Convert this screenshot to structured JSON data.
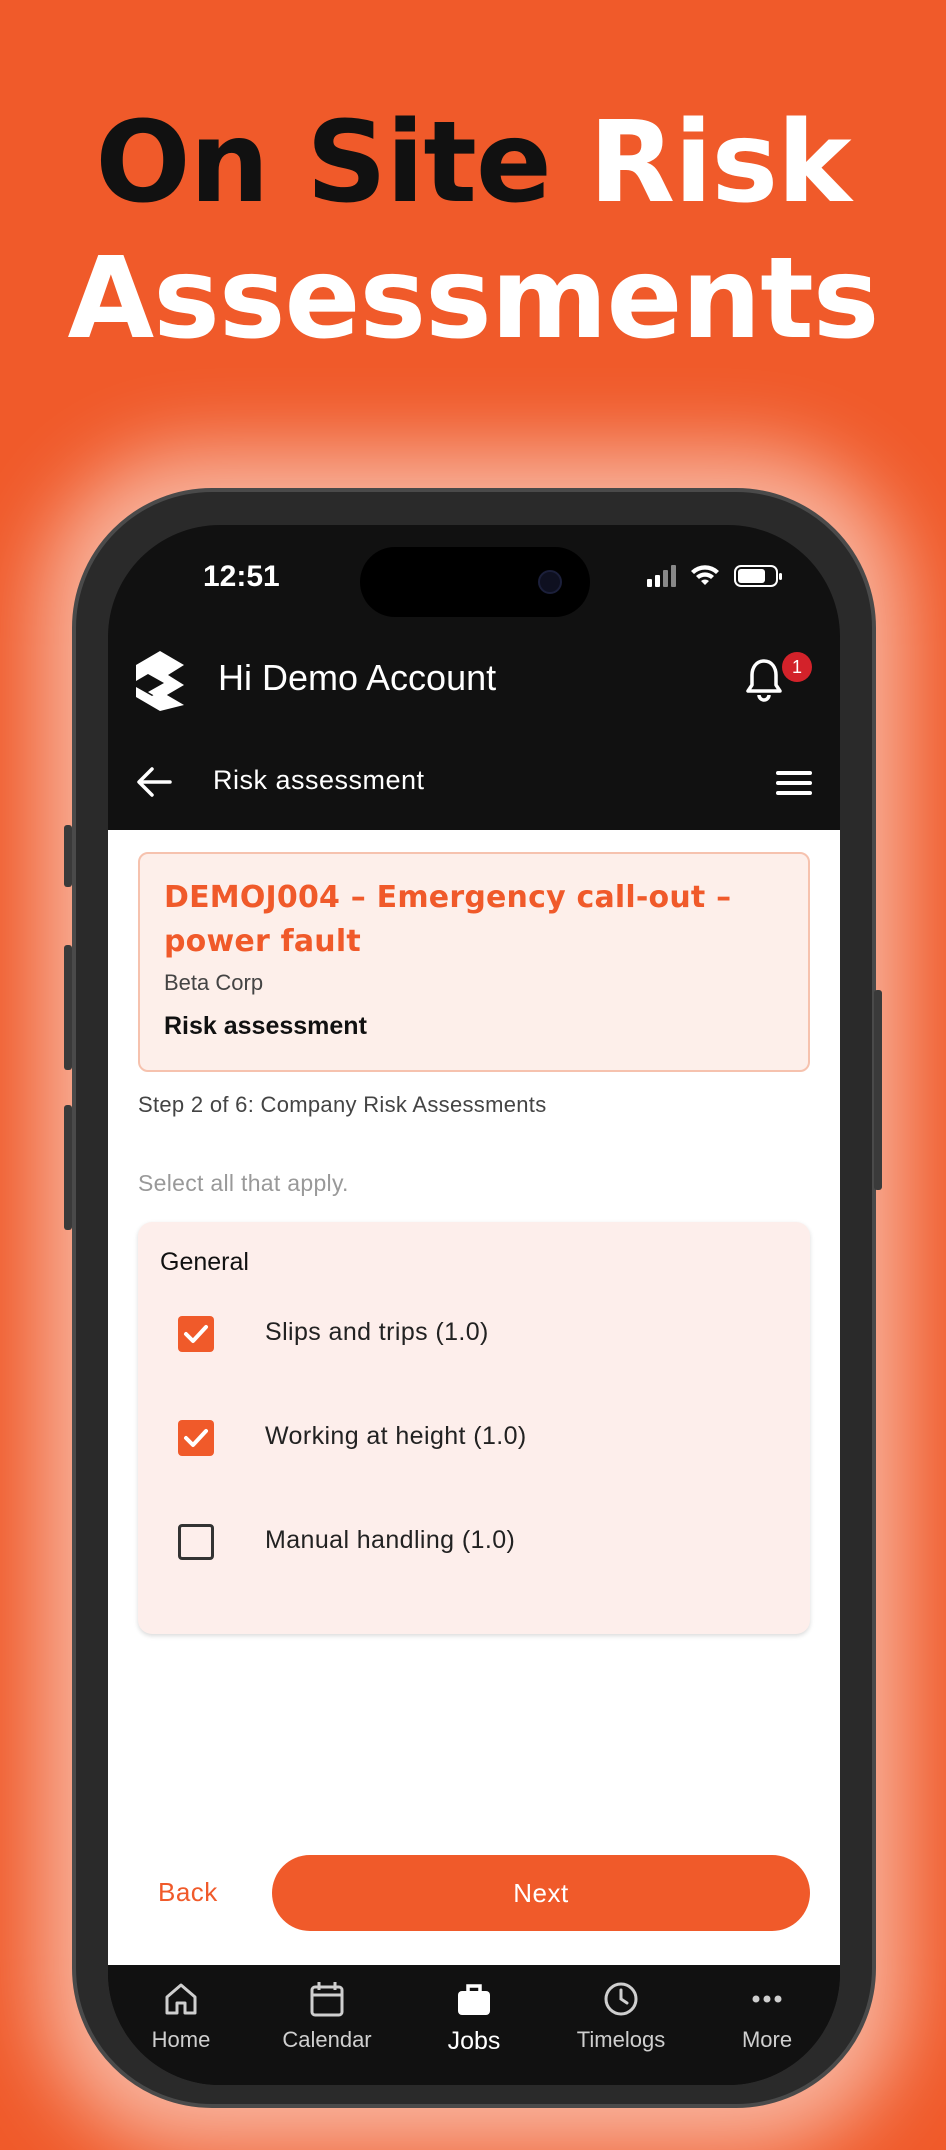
{
  "promo": {
    "headline_dark": "On Site",
    "headline_light_1": "Risk",
    "headline_light_2": "Assessments"
  },
  "status_bar": {
    "time": "12:51"
  },
  "header": {
    "greeting": "Hi Demo Account",
    "notification_count": "1"
  },
  "subheader": {
    "title": "Risk assessment"
  },
  "job": {
    "title": "DEMOJ004 – Emergency call-out – power fault",
    "client": "Beta Corp",
    "form_type": "Risk assessment"
  },
  "step": {
    "text": "Step 2 of 6: Company Risk Assessments",
    "hint": "Select all that apply."
  },
  "section": {
    "title": "General",
    "items": [
      {
        "label": "Slips and trips (1.0)",
        "checked": true
      },
      {
        "label": "Working at height (1.0)",
        "checked": true
      },
      {
        "label": "Manual handling (1.0)",
        "checked": false
      }
    ]
  },
  "actions": {
    "back_label": "Back",
    "next_label": "Next"
  },
  "tabs": [
    {
      "label": "Home",
      "icon": "home-icon",
      "active": false
    },
    {
      "label": "Calendar",
      "icon": "calendar-icon",
      "active": false
    },
    {
      "label": "Jobs",
      "icon": "briefcase-icon",
      "active": true
    },
    {
      "label": "Timelogs",
      "icon": "clock-icon",
      "active": false
    },
    {
      "label": "More",
      "icon": "more-icon",
      "active": false
    }
  ],
  "colors": {
    "brand_orange": "#F05A2A",
    "dark_bg": "#111111",
    "card_tint": "#FDEEEB",
    "badge_red": "#D3222A"
  }
}
